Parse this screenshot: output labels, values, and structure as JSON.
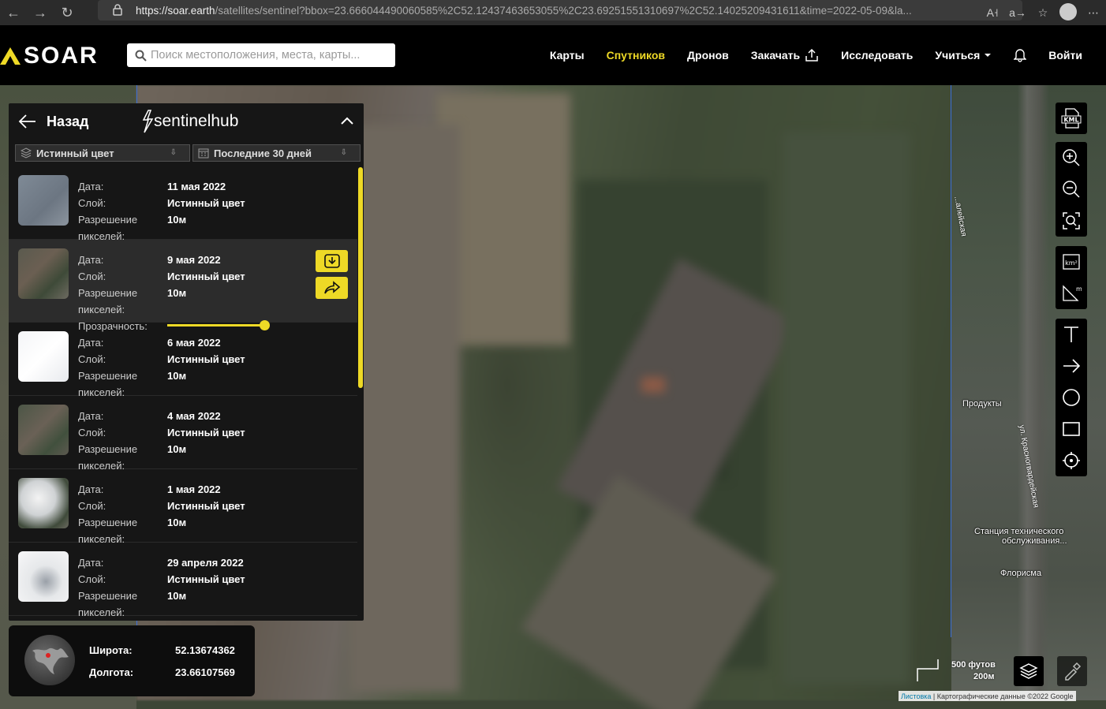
{
  "browser": {
    "url_host": "https://soar.earth",
    "url_rest": "/satellites/sentinel?bbox=23.666044490060585%2C52.12437463653055%2C23.69251551310697%2C52.14025209431611&time=2022-05-09&la..."
  },
  "header": {
    "logo": "SOAR",
    "search_placeholder": "Поиск местоположения, места, карты...",
    "nav": [
      {
        "label": "Карты"
      },
      {
        "label": "Спутников"
      },
      {
        "label": "Дронов"
      },
      {
        "label": "Закачать"
      },
      {
        "label": "Исследовать"
      },
      {
        "label": "Учиться"
      }
    ],
    "login": "Войти"
  },
  "panel": {
    "back_label": "Назад",
    "provider": "sentinelhub",
    "layer_select": "Истинный цвет",
    "date_select": "Последние 30 дней",
    "labels": {
      "date": "Дата:",
      "layer": "Слой:",
      "res1": "Разрешение",
      "res2": "пикселей:",
      "opacity": "Прозрачность:"
    },
    "items": [
      {
        "date": "11 мая 2022",
        "layer": "Истинный цвет",
        "res": "10м"
      },
      {
        "date": "9 мая 2022",
        "layer": "Истинный цвет",
        "res": "10м"
      },
      {
        "date": "6 мая 2022",
        "layer": "Истинный цвет",
        "res": "10м"
      },
      {
        "date": "4 мая 2022",
        "layer": "Истинный цвет",
        "res": "10м"
      },
      {
        "date": "1 мая 2022",
        "layer": "Истинный цвет",
        "res": "10м"
      },
      {
        "date": "29 апреля 2022",
        "layer": "Истинный цвет",
        "res": "10м"
      }
    ],
    "opacity_fraction": 1.0
  },
  "coords": {
    "lat_label": "Широта:",
    "lat": "52.13674362",
    "lon_label": "Долгота:",
    "lon": "23.66107569"
  },
  "map": {
    "poi": [
      "Продукты",
      "Станция технического",
      "обслуживания...",
      "Флорисма"
    ],
    "street": "ул. Красногвардейская",
    "street2": "...алейская",
    "scale_ft": "500 футов",
    "scale_m": "200м",
    "attrib_link": "Листовка",
    "attrib_text": "| Картографические данные ©2022 Google"
  },
  "tools": {
    "kml": "KML",
    "km": "km²",
    "m": "m"
  },
  "colors": {
    "accent": "#eed926",
    "panel": "#161616"
  }
}
